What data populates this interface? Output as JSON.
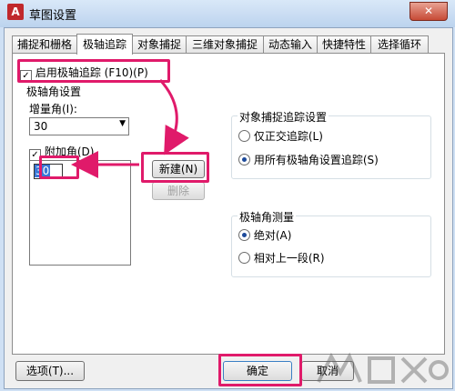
{
  "window": {
    "title": "草图设置",
    "app_icon": "A",
    "close_glyph": "✕"
  },
  "tabs": [
    {
      "label": "捕捉和栅格"
    },
    {
      "label": "极轴追踪"
    },
    {
      "label": "对象捕捉"
    },
    {
      "label": "三维对象捕捉"
    },
    {
      "label": "动态输入"
    },
    {
      "label": "快捷特性"
    },
    {
      "label": "选择循环"
    }
  ],
  "polar": {
    "enable_label": "启用极轴追踪 (F10)(P)",
    "enable_checked": "✓",
    "angle_group": "极轴角设置",
    "increment_label": "增量角(I):",
    "increment_value": "30",
    "additional_label": "附加角(D)",
    "additional_checked": "✓",
    "list_values": [
      "30"
    ],
    "new_button": "新建(N)",
    "delete_button": "删除"
  },
  "snap_tracking": {
    "group": "对象捕捉追踪设置",
    "option1": "仅正交追踪(L)",
    "option2": "用所有极轴角设置追踪(S)"
  },
  "measurement": {
    "group": "极轴角测量",
    "option1": "绝对(A)",
    "option2": "相对上一段(R)"
  },
  "footer": {
    "options": "选项(T)...",
    "ok": "确定",
    "cancel": "取消"
  },
  "colors": {
    "highlight": "#e01a6a"
  }
}
